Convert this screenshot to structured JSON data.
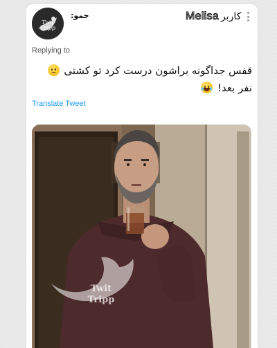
{
  "tweet": {
    "display_name": "جمو:",
    "account_name_latin": "Melisa",
    "account_name_suffix": "کاربر",
    "replying_label": "Replying to",
    "text_line1": "قفس جداگونه براشون درست کرد تو کشتی",
    "text_line2": "نفر بعد!",
    "translate_label": "Translate Tweet"
  },
  "avatar": {
    "text_line1": "Twit",
    "text_line2": "Tripp"
  },
  "watermark": {
    "line1": "Twit",
    "line2": "Tripp"
  },
  "colors": {
    "link": "#1d9bf0",
    "card": "#ffffff",
    "page": "#ebebeb"
  },
  "icons": [
    "more-vertical-icon",
    "sad-face-emoji",
    "laughing-face-emoji",
    "twit-tripp-logo"
  ]
}
